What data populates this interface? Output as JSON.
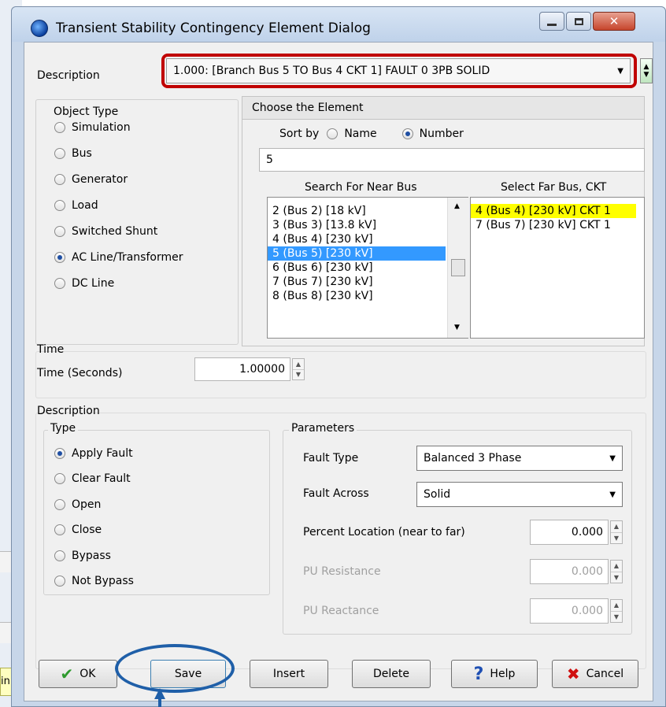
{
  "window": {
    "title": "Transient Stability Contingency Element Dialog"
  },
  "background": {
    "partial_text": "in"
  },
  "header": {
    "description_label": "Description",
    "description_value": "1.000: [Branch Bus 5  TO  Bus 4 CKT 1] FAULT 0 3PB SOLID"
  },
  "object_type": {
    "legend": "Object Type",
    "options": [
      {
        "label": "Simulation",
        "checked": false
      },
      {
        "label": "Bus",
        "checked": false
      },
      {
        "label": "Generator",
        "checked": false
      },
      {
        "label": "Load",
        "checked": false
      },
      {
        "label": "Switched Shunt",
        "checked": false
      },
      {
        "label": "AC Line/Transformer",
        "checked": true
      },
      {
        "label": "DC Line",
        "checked": false
      }
    ]
  },
  "choose": {
    "header": "Choose the Element",
    "sort_by_label": "Sort by",
    "sort_name": "Name",
    "sort_number": "Number",
    "search_value": "5",
    "near_header": "Search For Near Bus",
    "far_header": "Select Far Bus, CKT",
    "near_items": [
      "2 (Bus 2)  [18 kV]",
      "3 (Bus 3)  [13.8 kV]",
      "4 (Bus 4)  [230 kV]",
      "5 (Bus 5)  [230 kV]",
      "6 (Bus 6)  [230 kV]",
      "7 (Bus 7)  [230 kV]",
      "8 (Bus 8)  [230 kV]"
    ],
    "near_selected_index": 3,
    "far_items": [
      "4 (Bus 4) [230 kV] CKT  1",
      "7 (Bus 7) [230 kV] CKT  1"
    ],
    "far_selected_index": 0
  },
  "time": {
    "legend": "Time",
    "label": "Time (Seconds)",
    "value": "1.00000"
  },
  "description_group": {
    "legend": "Description"
  },
  "type_group": {
    "legend": "Type",
    "options": [
      {
        "label": "Apply Fault",
        "checked": true
      },
      {
        "label": "Clear Fault",
        "checked": false
      },
      {
        "label": "Open",
        "checked": false
      },
      {
        "label": "Close",
        "checked": false
      },
      {
        "label": "Bypass",
        "checked": false
      },
      {
        "label": "Not Bypass",
        "checked": false
      }
    ]
  },
  "parameters": {
    "legend": "Parameters",
    "fault_type_label": "Fault Type",
    "fault_type_value": "Balanced 3 Phase",
    "fault_across_label": "Fault Across",
    "fault_across_value": "Solid",
    "percent_label": "Percent Location (near to far)",
    "percent_value": "0.000",
    "pu_resistance_label": "PU Resistance",
    "pu_resistance_value": "0.000",
    "pu_reactance_label": "PU Reactance",
    "pu_reactance_value": "0.000"
  },
  "buttons": {
    "ok": "OK",
    "save": "Save",
    "insert": "Insert",
    "delete": "Delete",
    "help": "Help",
    "cancel": "Cancel"
  },
  "colors": {
    "annotation": "#c00000",
    "circle": "#1f5fa8",
    "list_selection": "#3399ff",
    "far_selection": "#ffff00"
  }
}
